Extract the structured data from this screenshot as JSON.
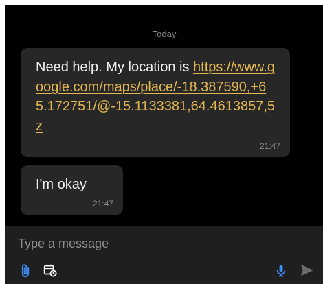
{
  "conversation": {
    "date_separator": "Today",
    "messages": [
      {
        "text": "Need help. My location is",
        "link": "https://www.google.com/maps/place/-18.387590,+65.172751/@-15.1133381,64.4613857,5z",
        "time": "21:47"
      },
      {
        "text": "I'm okay",
        "time": "21:47"
      }
    ]
  },
  "composer": {
    "placeholder": "Type a message",
    "icons": {
      "attach": "paperclip-icon",
      "schedule": "calendar-clock-icon",
      "voice": "microphone-icon",
      "send": "send-icon"
    }
  },
  "colors": {
    "background": "#000000",
    "bubble": "#272727",
    "link": "#e2b652",
    "accent": "#3d8bf2",
    "composer_background": "#1f1f1f"
  }
}
